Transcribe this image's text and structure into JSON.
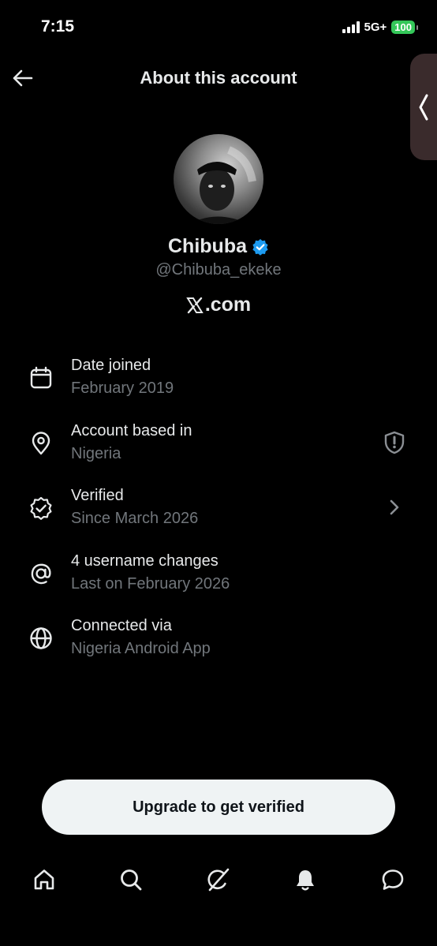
{
  "status_bar": {
    "time": "7:15",
    "network": "5G+",
    "battery": "100"
  },
  "header": {
    "title": "About this account"
  },
  "profile": {
    "name": "Chibuba",
    "handle": "@Chibuba_ekeke",
    "site": ".com",
    "verified_color": "#1d9bf0"
  },
  "info_items": [
    {
      "icon": "calendar-icon",
      "title": "Date joined",
      "subtitle": "February 2019"
    },
    {
      "icon": "location-pin-icon",
      "title": "Account based in",
      "subtitle": "Nigeria",
      "trailing_icon": "shield-alert-icon"
    },
    {
      "icon": "verified-badge-icon",
      "title": "Verified",
      "subtitle": "Since March 2026",
      "trailing_icon": "chevron-right-icon"
    },
    {
      "icon": "at-sign-icon",
      "title": "4 username changes",
      "subtitle": "Last on February 2026"
    },
    {
      "icon": "globe-icon",
      "title": "Connected via",
      "subtitle": "Nigeria Android App"
    }
  ],
  "upgrade_button": {
    "label": "Upgrade to get verified"
  },
  "tab_bar": [
    {
      "icon": "home-icon"
    },
    {
      "icon": "search-icon"
    },
    {
      "icon": "grok-icon"
    },
    {
      "icon": "notifications-bell-icon"
    },
    {
      "icon": "messages-icon"
    }
  ],
  "colors": {
    "background": "#000000",
    "primary_text": "#e7e9ea",
    "secondary_text": "#71767b",
    "button_bg": "#eff3f4",
    "battery_green": "#34c759"
  }
}
